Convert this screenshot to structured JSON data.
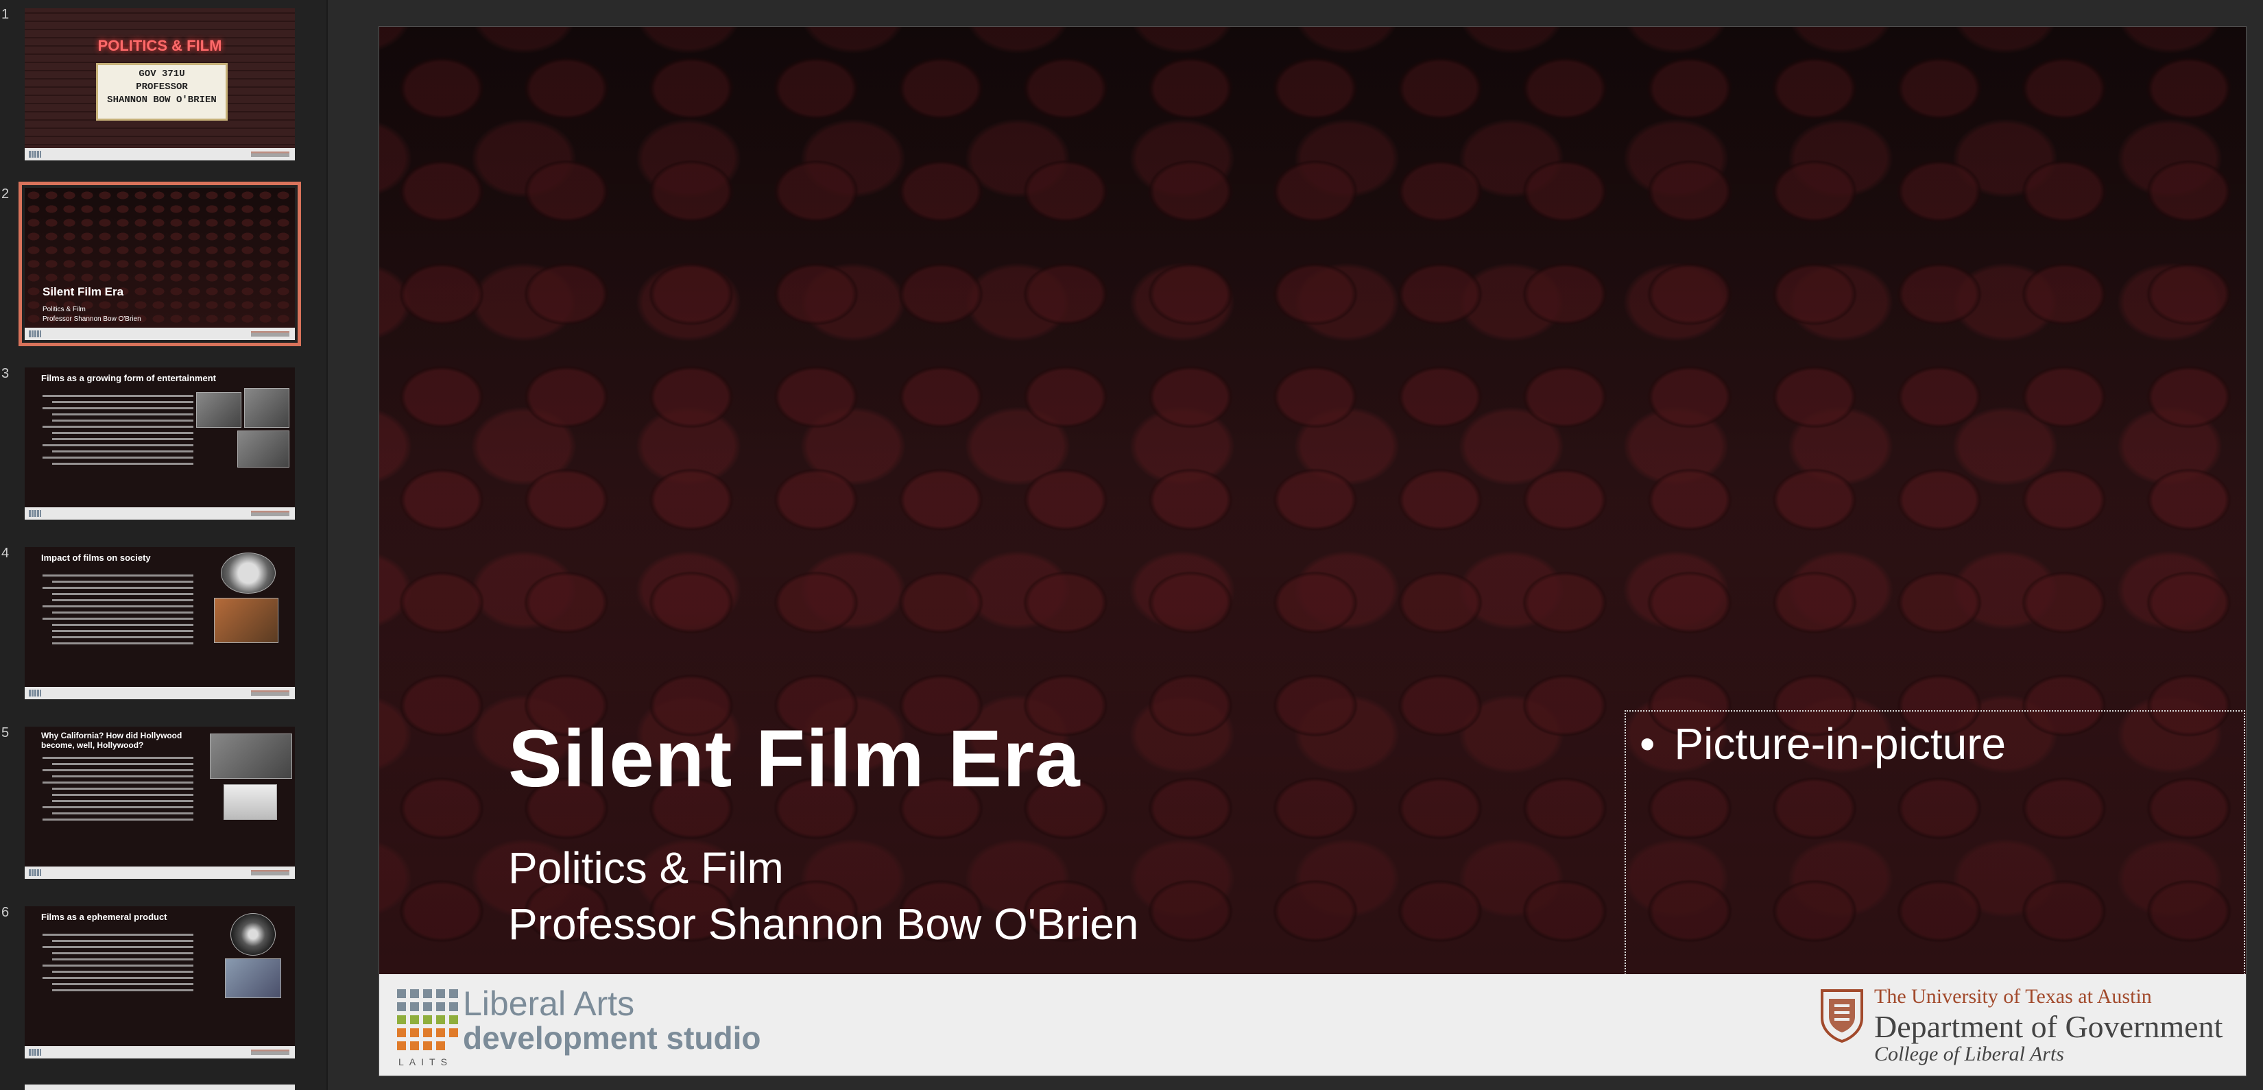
{
  "thumbnails": [
    {
      "number": "1",
      "marquee_title": "POLITICS & FILM",
      "marquee_lines": [
        "GOV 371U",
        "PROFESSOR",
        "SHANNON BOW O'BRIEN"
      ]
    },
    {
      "number": "2",
      "title": "Silent Film Era",
      "sub1": "Politics & Film",
      "sub2": "Professor Shannon Bow O'Brien"
    },
    {
      "number": "3",
      "title": "Films as a growing form of entertainment"
    },
    {
      "number": "4",
      "title": "Impact of films on society"
    },
    {
      "number": "5",
      "title": "Why California? How did Hollywood become, well, Hollywood?"
    },
    {
      "number": "6",
      "title": "Films as a ephemeral product"
    }
  ],
  "slide": {
    "title": "Silent Film Era",
    "subtitle_line1": "Politics & Film",
    "subtitle_line2": "Professor Shannon Bow O'Brien",
    "pip_text": "Picture-in-picture"
  },
  "footer": {
    "left_line1": "Liberal Arts",
    "left_line2": "development studio",
    "left_caption": "LAITS",
    "right_line1": "The University of Texas at Austin",
    "right_line2": "Department of Government",
    "right_line3": "College of Liberal Arts"
  },
  "colors": {
    "selected_outline": "#d9735b",
    "ut_orange": "#a24a2c",
    "laits_grey": "#7c8c99"
  }
}
